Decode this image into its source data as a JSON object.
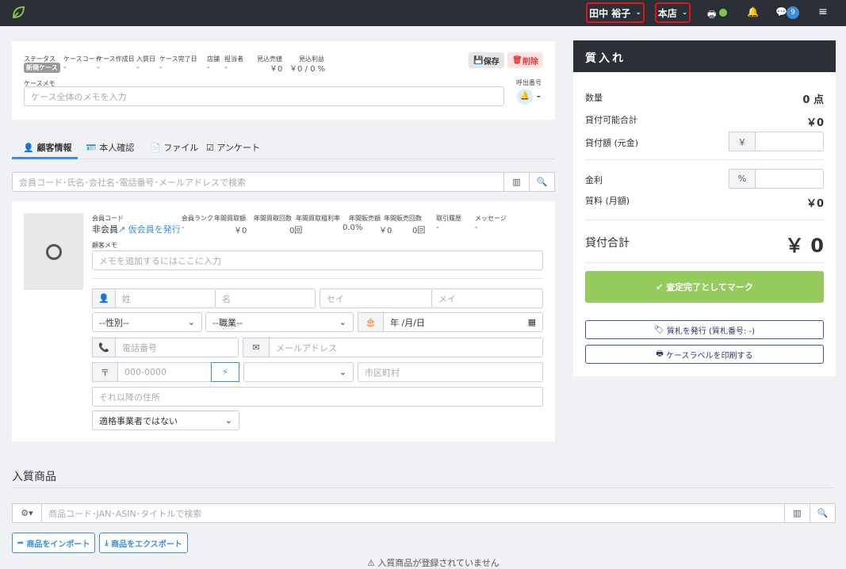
{
  "topbar": {
    "user": "田中 裕子",
    "store": "本店",
    "message_count": "9",
    "printer_status_color": "#8bc34a"
  },
  "case": {
    "labels": [
      "ステータス",
      "ケースコード",
      "ケース作成日",
      "入質日",
      "ケース完了日",
      "店舗",
      "担当者",
      "見込売値",
      "見込利益"
    ],
    "status_badge": "新規ケース",
    "values": [
      "-",
      "-",
      "-",
      "-",
      "-",
      "-"
    ],
    "expected_price": "￥0",
    "expected_profit": "￥0 / 0 %",
    "memo_label": "ケースメモ",
    "memo_placeholder": "ケース全体のメモを入力",
    "save": "保存",
    "delete": "削除",
    "call_label": "呼出番号",
    "call_value": "-"
  },
  "tabs": [
    "顧客情報",
    "本人確認",
    "ファイル",
    "アンケート"
  ],
  "customer_search_placeholder": "会員コード･氏名･会社名･電話番号･メールアドレスで検索",
  "customer": {
    "code_label": "会員コード",
    "code_value": "非会員",
    "issue_link": "仮会員を発行",
    "stats": [
      {
        "l": "会員ランク",
        "v": "-"
      },
      {
        "l": "年間買取額",
        "v": "￥0"
      },
      {
        "l": "年間買取回数",
        "v": "0回"
      },
      {
        "l": "年間買取粗利率",
        "v": "0.0%"
      },
      {
        "l": "年間販売額",
        "v": "￥0"
      },
      {
        "l": "年間販売回数",
        "v": "0回"
      },
      {
        "l": "取引履歴",
        "v": "-"
      },
      {
        "l": "メッセージ",
        "v": "-"
      }
    ],
    "memo_label": "顧客メモ",
    "memo_placeholder": "メモを追加するにはここに入力",
    "last_name": "姓",
    "first_name": "名",
    "last_kana": "セイ",
    "first_kana": "メイ",
    "gender": "--性別--",
    "job": "--職業--",
    "birthday": "年 /月/日",
    "phone": "電話番号",
    "email": "メールアドレス",
    "zip": "000-0000",
    "city": "市区町村",
    "address": "それ以降の住所",
    "invoice": "適格事業者ではない"
  },
  "items": {
    "title": "入質商品",
    "search_placeholder": "商品コード･JAN･ASIN･タイトルで検索",
    "import": "商品をインポート",
    "export": "商品をエクスポート",
    "empty": "入質商品が登録されていません"
  },
  "panel": {
    "title": "質入れ",
    "qty_label": "数量",
    "qty": "0 点",
    "lendable_label": "貸付可能合計",
    "lendable": "￥0",
    "loan_label": "貸付額 (元金)",
    "yen": "￥",
    "rate_label": "金利",
    "pct": "%",
    "fee_label": "質料 (月額)",
    "fee": "￥0",
    "total_label": "貸付合計",
    "total": "￥ 0",
    "complete": "査定完了としてマーク",
    "ticket": "質札を発行 (質札番号: -)",
    "label_print": "ケースラベルを印刷する",
    "accent": "#94cb5c"
  }
}
